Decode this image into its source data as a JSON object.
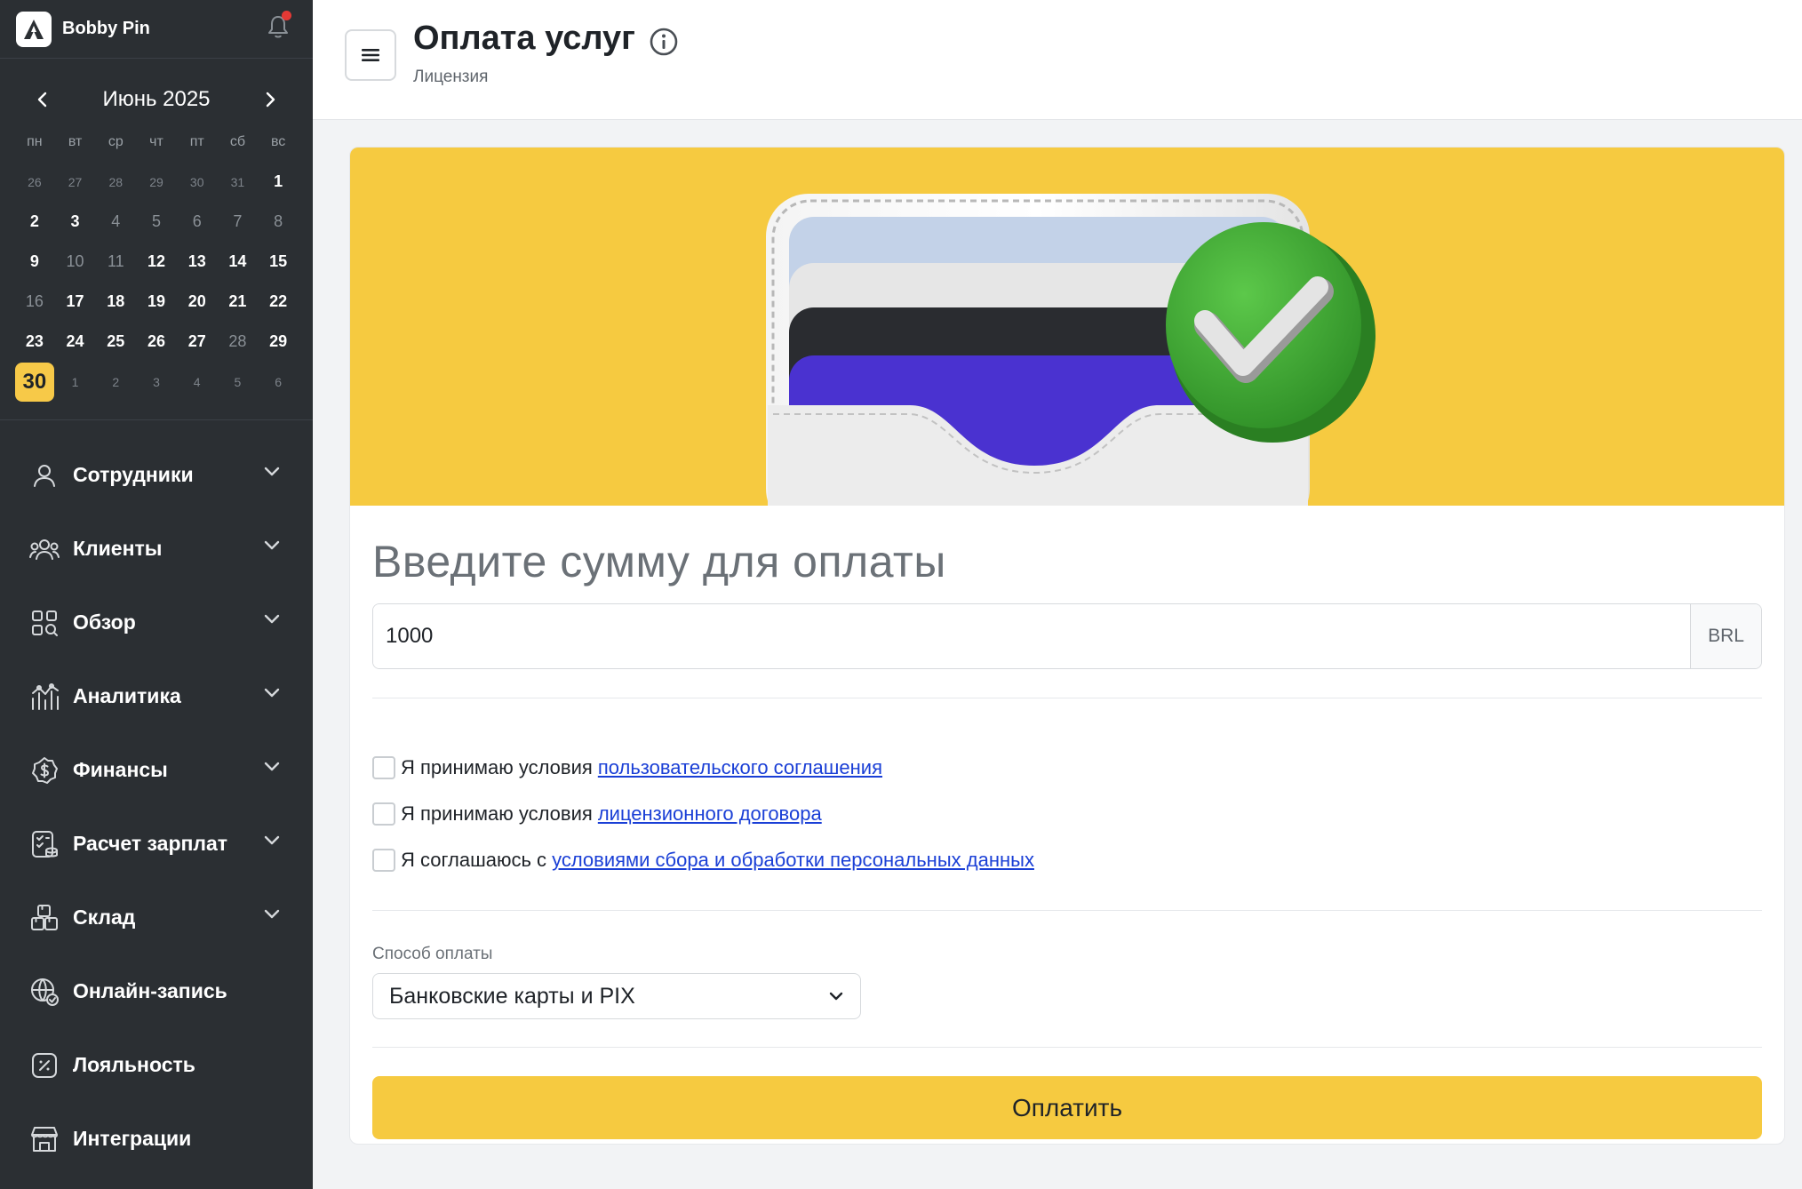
{
  "app": {
    "user_name": "Bobby Pin"
  },
  "calendar": {
    "title": "Июнь 2025",
    "weekdays": [
      "пн",
      "вт",
      "ср",
      "чт",
      "пт",
      "сб",
      "вс"
    ],
    "days": [
      {
        "d": "26",
        "t": "muted"
      },
      {
        "d": "27",
        "t": "muted"
      },
      {
        "d": "28",
        "t": "muted"
      },
      {
        "d": "29",
        "t": "muted"
      },
      {
        "d": "30",
        "t": "muted"
      },
      {
        "d": "31",
        "t": "muted"
      },
      {
        "d": "1",
        "t": "normal"
      },
      {
        "d": "2",
        "t": "normal"
      },
      {
        "d": "3",
        "t": "normal"
      },
      {
        "d": "4",
        "t": "dim"
      },
      {
        "d": "5",
        "t": "dim"
      },
      {
        "d": "6",
        "t": "dim"
      },
      {
        "d": "7",
        "t": "dim"
      },
      {
        "d": "8",
        "t": "dim"
      },
      {
        "d": "9",
        "t": "normal"
      },
      {
        "d": "10",
        "t": "dim"
      },
      {
        "d": "11",
        "t": "dim"
      },
      {
        "d": "12",
        "t": "normal"
      },
      {
        "d": "13",
        "t": "normal"
      },
      {
        "d": "14",
        "t": "normal"
      },
      {
        "d": "15",
        "t": "normal"
      },
      {
        "d": "16",
        "t": "dim"
      },
      {
        "d": "17",
        "t": "normal"
      },
      {
        "d": "18",
        "t": "normal"
      },
      {
        "d": "19",
        "t": "normal"
      },
      {
        "d": "20",
        "t": "normal"
      },
      {
        "d": "21",
        "t": "normal"
      },
      {
        "d": "22",
        "t": "normal"
      },
      {
        "d": "23",
        "t": "normal"
      },
      {
        "d": "24",
        "t": "normal"
      },
      {
        "d": "25",
        "t": "normal"
      },
      {
        "d": "26",
        "t": "normal"
      },
      {
        "d": "27",
        "t": "normal"
      },
      {
        "d": "28",
        "t": "dim"
      },
      {
        "d": "29",
        "t": "normal"
      },
      {
        "d": "30",
        "t": "today"
      },
      {
        "d": "1",
        "t": "muted"
      },
      {
        "d": "2",
        "t": "muted"
      },
      {
        "d": "3",
        "t": "muted"
      },
      {
        "d": "4",
        "t": "muted"
      },
      {
        "d": "5",
        "t": "muted"
      },
      {
        "d": "6",
        "t": "muted"
      }
    ]
  },
  "menu": [
    {
      "label": "Сотрудники",
      "icon": "user-icon",
      "expandable": true
    },
    {
      "label": "Клиенты",
      "icon": "users-icon",
      "expandable": true
    },
    {
      "label": "Обзор",
      "icon": "grid-icon",
      "expandable": true
    },
    {
      "label": "Аналитика",
      "icon": "analytics-icon",
      "expandable": true
    },
    {
      "label": "Финансы",
      "icon": "dollar-badge-icon",
      "expandable": true
    },
    {
      "label": "Расчет зарплат",
      "icon": "payroll-icon",
      "expandable": true
    },
    {
      "label": "Склад",
      "icon": "boxes-icon",
      "expandable": true
    },
    {
      "label": "Онлайн-запись",
      "icon": "globe-check-icon",
      "expandable": false
    },
    {
      "label": "Лояльность",
      "icon": "discount-icon",
      "expandable": false
    },
    {
      "label": "Интеграции",
      "icon": "storefront-icon",
      "expandable": false
    }
  ],
  "header": {
    "title": "Оплата услуг",
    "subtitle": "Лицензия"
  },
  "payment": {
    "amount_title": "Введите сумму для оплаты",
    "amount_value": "1000",
    "currency": "BRL",
    "agreements": [
      {
        "prefix": "Я принимаю условия",
        "link": "пользовательского соглашения",
        "checked": false
      },
      {
        "prefix": "Я принимаю условия",
        "link": "лицензионного договора",
        "checked": false
      },
      {
        "prefix": "Я соглашаюсь с",
        "link": "условиями сбора и обработки персональных данных",
        "checked": false
      }
    ],
    "method_label": "Способ оплаты",
    "method_value": "Банковские карты и PIX",
    "pay_button": "Оплатить"
  },
  "colors": {
    "accent": "#f6ca40",
    "sidebar": "#2b2f33",
    "link": "#1a3fd6",
    "success": "#3fa535"
  }
}
